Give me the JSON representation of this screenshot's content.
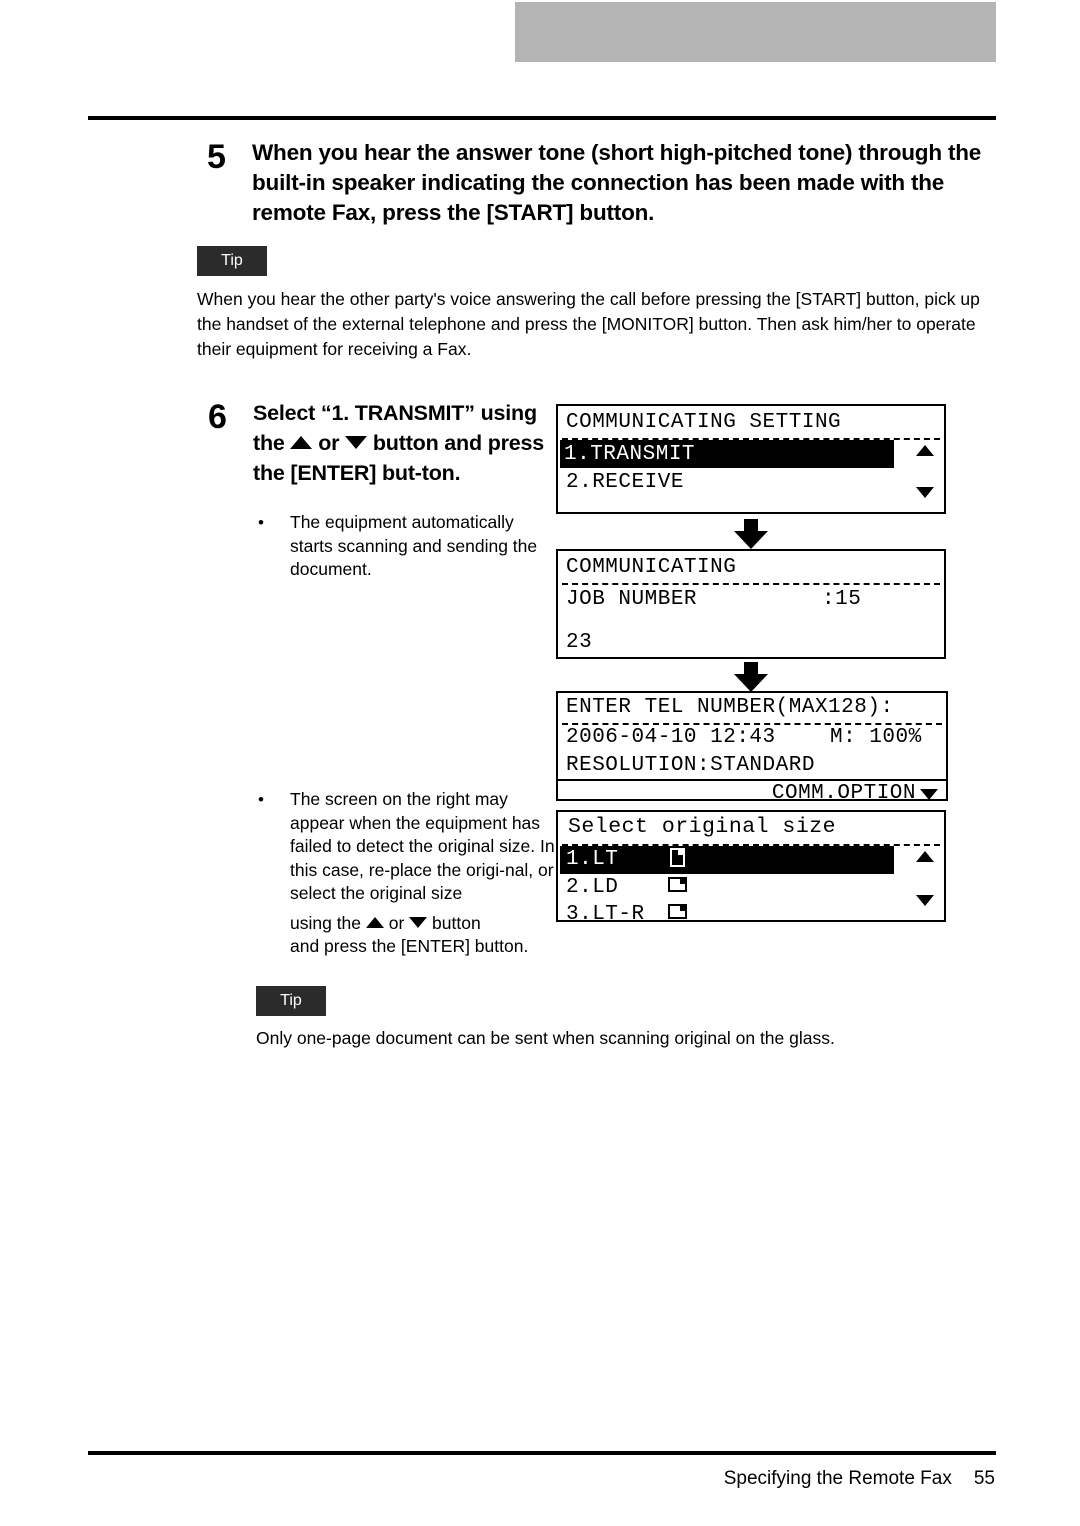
{
  "page": {
    "footer_title": "Specifying the Remote Fax",
    "footer_page_number": "55"
  },
  "steps": [
    {
      "number": "5",
      "title": "When you hear the answer tone (short high-pitched tone) through the built-in speaker indicating the connection has been made with the remote Fax, press the [START] button."
    },
    {
      "number": "6",
      "title_part1": "Select “1. TRANSMIT” using the ",
      "title_or": " or ",
      "title_part2": " button and press the [ENTER] but-ton."
    }
  ],
  "tips": [
    {
      "label": "Tip",
      "body": "When you hear the other party's voice answering the call before pressing the [START] button, pick up the handset of the external telephone and press the [MONITOR] button. Then ask him/her to operate their equipment for receiving a Fax."
    },
    {
      "label": "Tip",
      "body": "Only one-page document can be sent when scanning original on the glass."
    }
  ],
  "bullets": [
    {
      "marker": "•",
      "text": "The equipment automatically starts scanning and sending the document."
    },
    {
      "marker": "•",
      "text_part1": "The screen on the right may appear when the equipment has failed to detect the original size. In this case, re-place the origi-nal, or select the original size",
      "text_line2_a": "using the ",
      "text_line2_or": " or ",
      "text_line2_b": " button",
      "text_line3": "and press the [ENTER] button."
    }
  ],
  "lcd_screens": [
    {
      "id": "communicating-setting",
      "title": "COMMUNICATING SETTING",
      "rows": [
        {
          "label": "1.TRANSMIT",
          "selected": true
        },
        {
          "label": "2.RECEIVE",
          "selected": false
        }
      ],
      "scroll_up": "▲",
      "scroll_down": "▼"
    },
    {
      "id": "communicating",
      "title": "COMMUNICATING",
      "field_label": "JOB NUMBER",
      "field_value": ":15",
      "bottom_value": "23"
    },
    {
      "id": "enter-tel-number",
      "title": "ENTER TEL NUMBER(MAX128):",
      "datetime": "2006-04-10 12:43",
      "memory": "M: 100%",
      "resolution": "RESOLUTION:STANDARD",
      "soft_key": "COMM.OPTION",
      "soft_key_arrow": "▼"
    },
    {
      "id": "select-original-size",
      "title": "Select original size",
      "rows": [
        {
          "label": "1.LT",
          "icon": "page-portrait-icon",
          "selected": true
        },
        {
          "label": "2.LD",
          "icon": "page-landscape-icon",
          "selected": false
        },
        {
          "label": "3.LT-R",
          "icon": "page-landscape-icon",
          "selected": false
        }
      ],
      "scroll_up": "▲",
      "scroll_down": "▼"
    }
  ],
  "colors": {
    "header_band": "#b4b4b4",
    "tip_badge": "#2b2b2b",
    "ink": "#000000"
  }
}
